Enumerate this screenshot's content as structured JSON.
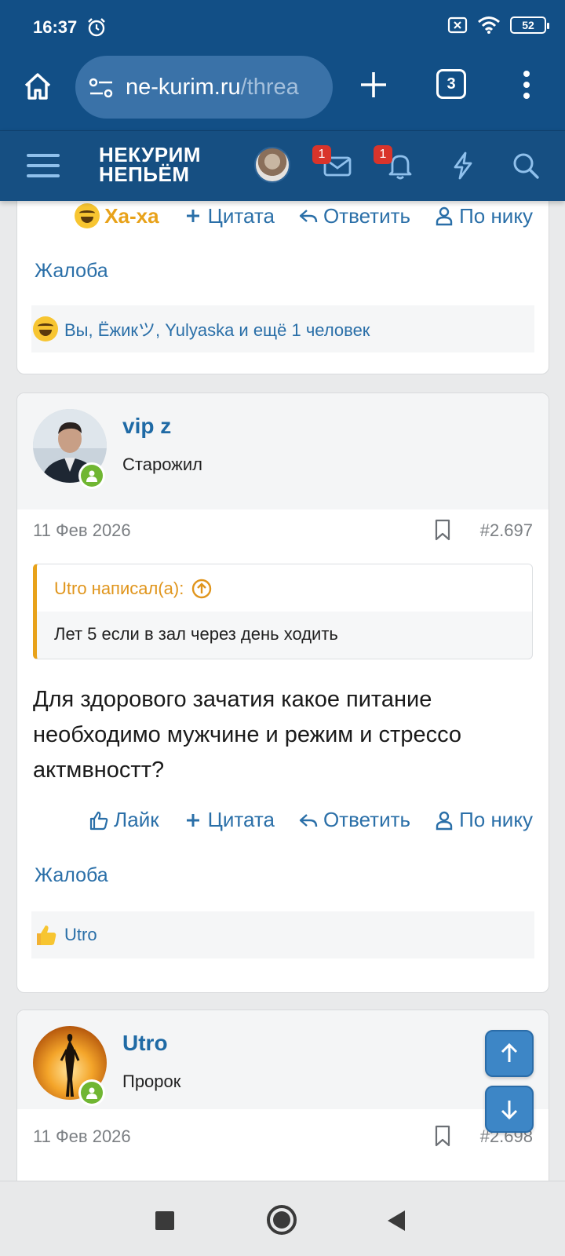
{
  "status": {
    "time": "16:37",
    "battery": "52"
  },
  "browser": {
    "url_domain": "ne-kurim.ru",
    "url_path": "/threa",
    "tab_count": "3"
  },
  "site": {
    "logo_line1": "НЕКУРИМ",
    "logo_line2": "НЕПЬЁМ",
    "messages_badge": "1",
    "alerts_badge": "1"
  },
  "post_prev": {
    "actions": {
      "reaction": "Ха-ха",
      "quote": "Цитата",
      "reply": "Ответить",
      "by_nick": "По нику"
    },
    "complaint": "Жалоба",
    "reactions_text": "Вы, Ёжикツ, Yulyaska и ещё 1 человек"
  },
  "post_2697": {
    "username": "vip z",
    "user_title": "Старожил",
    "date": "11 Фев 2026",
    "number": "#2.697",
    "quote_author": "Utro написал(а):",
    "quote_text": "Лет 5 если в зал через день ходить",
    "text": "Для здорового зачатия какое питание необходимо мужчине и режим и стрессо актмвностт?",
    "actions": {
      "like": "Лайк",
      "quote": "Цитата",
      "reply": "Ответить",
      "by_nick": "По нику"
    },
    "complaint": "Жалоба",
    "reactions_text": "Utro"
  },
  "post_2698": {
    "username": "Utro",
    "user_title": "Пророк",
    "date": "11 Фев 2026",
    "number": "#2.698"
  }
}
